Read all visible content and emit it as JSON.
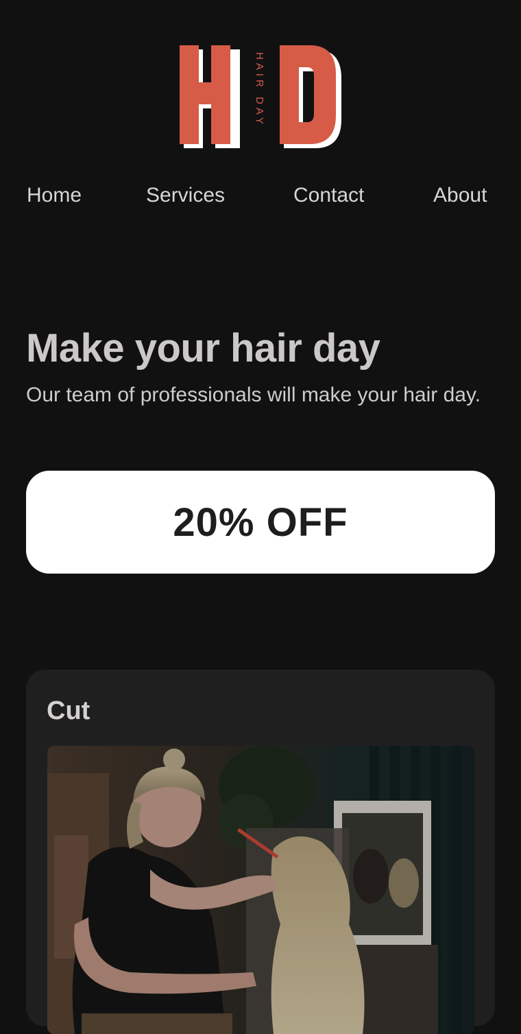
{
  "brand": {
    "logo_letters": "HD",
    "logo_tagline": "HAIR DAY",
    "accent_color": "#d65c48"
  },
  "nav": {
    "items": [
      "Home",
      "Services",
      "Contact",
      "About"
    ]
  },
  "hero": {
    "title": "Make your hair day",
    "subtitle": "Our team of professionals will make your hair day."
  },
  "promo": {
    "label": "20% OFF"
  },
  "services": [
    {
      "title": "Cut",
      "image_icon": "stylist-cutting-hair-photo"
    }
  ]
}
